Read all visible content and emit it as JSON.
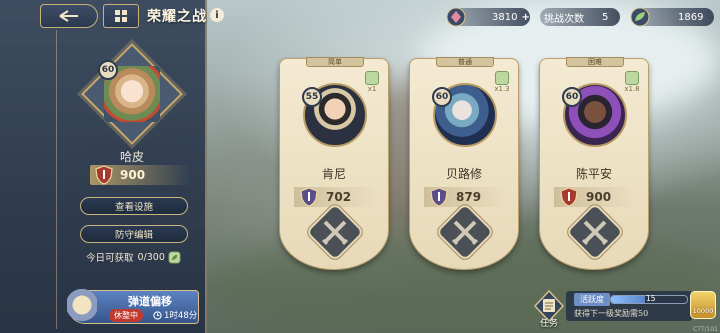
{
  "header": {
    "title": "荣耀之战",
    "back_icon": "back-arrow-icon",
    "menu_icon": "grid-menu-icon",
    "info_icon": "i"
  },
  "resources": {
    "gems": {
      "value": "3810",
      "plus": "+"
    },
    "challenges": {
      "label": "挑战次数",
      "value": "5"
    },
    "leaves": {
      "value": "1869"
    }
  },
  "player": {
    "level": "60",
    "name": "哈皮",
    "power": "900"
  },
  "left_buttons": {
    "view_defense": "查看设施",
    "defense_edit": "防守编辑"
  },
  "daily": {
    "label": "今日可获取",
    "value": "0/300"
  },
  "event": {
    "title": "弹道偏移",
    "status": "休整中",
    "time": "1时48分"
  },
  "opponents": [
    {
      "difficulty": "简单",
      "multiplier": "x1",
      "level": "55",
      "name": "肯尼",
      "power": "702",
      "badge_color": "#5b4f8a"
    },
    {
      "difficulty": "普通",
      "multiplier": "x1.3",
      "level": "60",
      "name": "贝路修",
      "power": "879",
      "badge_color": "#5b4f8a"
    },
    {
      "difficulty": "困难",
      "multiplier": "x1.8",
      "level": "60",
      "name": "陈平安",
      "power": "900",
      "badge_color": "#a53a2e"
    }
  ],
  "activity": {
    "task_label": "任务",
    "label": "活跃度",
    "value": "15",
    "progress": 0.45,
    "hint": "获得下一级奖励需50",
    "chest_value": "10000"
  },
  "corner_text": "CTT/101"
}
